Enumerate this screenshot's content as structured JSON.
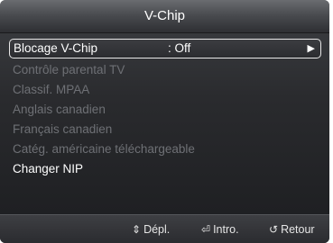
{
  "window": {
    "title": "V-Chip"
  },
  "menu": {
    "items": [
      {
        "label": "Blocage V-Chip",
        "value": ": Off",
        "state": "selected"
      },
      {
        "label": "Contrôle parental TV",
        "state": "disabled"
      },
      {
        "label": "Classif. MPAA",
        "state": "disabled"
      },
      {
        "label": "Anglais canadien",
        "state": "disabled"
      },
      {
        "label": "Français canadien",
        "state": "disabled"
      },
      {
        "label": "Catég. américaine téléchargeable",
        "state": "disabled"
      },
      {
        "label": "Changer NIP",
        "state": "active"
      }
    ],
    "selected_arrow_icon": "triangle-right-icon"
  },
  "footer": {
    "move": {
      "icon": "updown-arrow-icon",
      "label": "Dépl."
    },
    "enter": {
      "icon": "enter-icon",
      "label": "Intro."
    },
    "return": {
      "icon": "return-icon",
      "label": "Retour"
    }
  },
  "colors": {
    "text_active": "#ffffff",
    "text_disabled": "#6e7075",
    "highlight_border": "#e8e8e8"
  }
}
